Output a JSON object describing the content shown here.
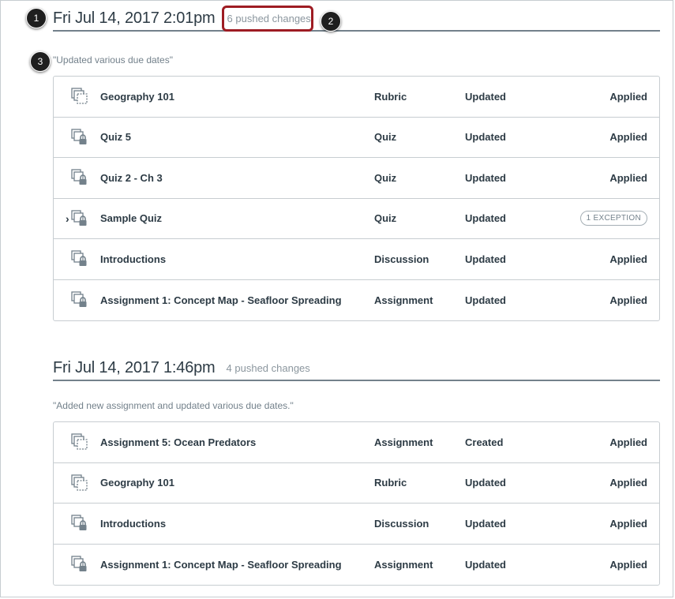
{
  "syncs": [
    {
      "date": "Fri Jul 14, 2017 2:01pm",
      "pushed": "6 pushed changes",
      "message": "\"Updated various due dates\"",
      "rows": [
        {
          "icon": "rubric-icon",
          "name": "Geography 101",
          "type": "Rubric",
          "change": "Updated",
          "status": "Applied",
          "exception": false
        },
        {
          "icon": "locked-content-icon",
          "name": "Quiz 5",
          "type": "Quiz",
          "change": "Updated",
          "status": "Applied",
          "exception": false
        },
        {
          "icon": "locked-content-icon",
          "name": "Quiz 2 - Ch 3",
          "type": "Quiz",
          "change": "Updated",
          "status": "Applied",
          "exception": false
        },
        {
          "icon": "locked-content-icon",
          "name": "Sample Quiz",
          "type": "Quiz",
          "change": "Updated",
          "status": "1 EXCEPTION",
          "exception": true
        },
        {
          "icon": "locked-content-icon",
          "name": "Introductions",
          "type": "Discussion",
          "change": "Updated",
          "status": "Applied",
          "exception": false
        },
        {
          "icon": "locked-content-icon",
          "name": "Assignment 1: Concept Map - Seafloor Spreading",
          "type": "Assignment",
          "change": "Updated",
          "status": "Applied",
          "exception": false
        }
      ]
    },
    {
      "date": "Fri Jul 14, 2017 1:46pm",
      "pushed": "4 pushed changes",
      "message": "\"Added new assignment and updated various due dates.\"",
      "rows": [
        {
          "icon": "unlocked-content-icon",
          "name": "Assignment 5: Ocean Predators",
          "type": "Assignment",
          "change": "Created",
          "status": "Applied",
          "exception": false
        },
        {
          "icon": "rubric-icon",
          "name": "Geography 101",
          "type": "Rubric",
          "change": "Updated",
          "status": "Applied",
          "exception": false
        },
        {
          "icon": "locked-content-icon",
          "name": "Introductions",
          "type": "Discussion",
          "change": "Updated",
          "status": "Applied",
          "exception": false
        },
        {
          "icon": "locked-content-icon",
          "name": "Assignment 1: Concept Map - Seafloor Spreading",
          "type": "Assignment",
          "change": "Updated",
          "status": "Applied",
          "exception": false
        }
      ]
    }
  ],
  "callouts": [
    "1",
    "2",
    "3"
  ],
  "expand_glyph": "›",
  "colors": {
    "highlight": "#9e1c23",
    "callout": "#1f1f1f",
    "border": "#c7cdd1"
  }
}
